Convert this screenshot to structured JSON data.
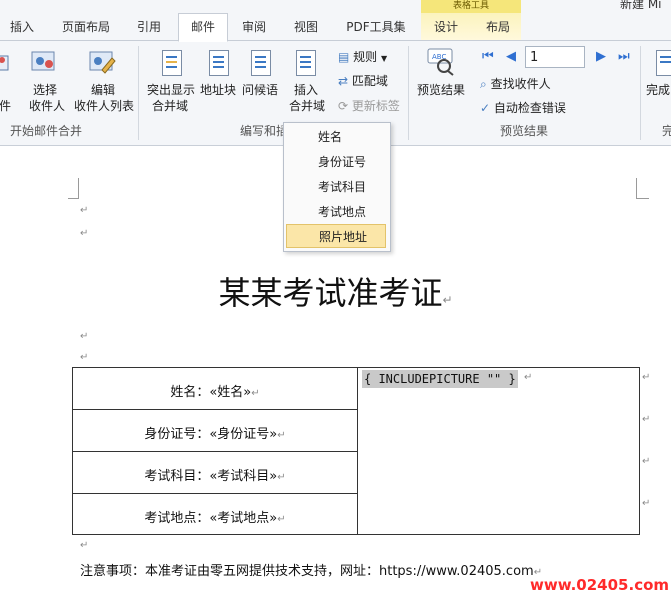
{
  "window": {
    "title_fragment": "新建 Mi"
  },
  "tabs": [
    {
      "label": "插入"
    },
    {
      "label": "页面布局"
    },
    {
      "label": "引用"
    },
    {
      "label": "邮件"
    },
    {
      "label": "审阅"
    },
    {
      "label": "视图"
    },
    {
      "label": "PDF工具集"
    },
    {
      "label": "设计"
    },
    {
      "label": "布局"
    }
  ],
  "context_tab_group": "表格工具",
  "ribbon": {
    "group1": {
      "name": "开始邮件合并",
      "partial_label": "件",
      "select_top": "选择",
      "select_bottom": "收件人",
      "edit_top": "编辑",
      "edit_bottom": "收件人列表"
    },
    "group2": {
      "name": "编写和插",
      "highlight_top": "突出显示",
      "highlight_bottom": "合并域",
      "address_block": "地址块",
      "greeting": "问候语",
      "insert_top": "插入",
      "insert_bottom": "合并域",
      "rules": "规则",
      "match_fields": "匹配域",
      "update_labels": "更新标签"
    },
    "group3": {
      "name": "预览结果",
      "preview_results": "预览结果",
      "record_number": "1",
      "find_recipient": "查找收件人",
      "auto_check": "自动检查错误"
    },
    "group4": {
      "partial_button": "完成",
      "partial_group": "完"
    }
  },
  "dropdown": {
    "items": [
      {
        "label": "姓名"
      },
      {
        "label": "身份证号"
      },
      {
        "label": "考试科目"
      },
      {
        "label": "考试地点"
      },
      {
        "label": "照片地址"
      }
    ]
  },
  "document": {
    "paragraph_mark": "↵",
    "title": "某某考试准考证",
    "rows": [
      {
        "label": "姓名：",
        "field": "«姓名»"
      },
      {
        "label": "身份证号：",
        "field": "«身份证号»"
      },
      {
        "label": "考试科目：",
        "field": "«考试科目»"
      },
      {
        "label": "考试地点：",
        "field": "«考试地点»"
      }
    ],
    "field_code": "{ INCLUDEPICTURE \"\" }",
    "note": "注意事项：本准考证由零五网提供技术支持，网址：https://www.02405.com",
    "watermark": "www.02405.com"
  }
}
